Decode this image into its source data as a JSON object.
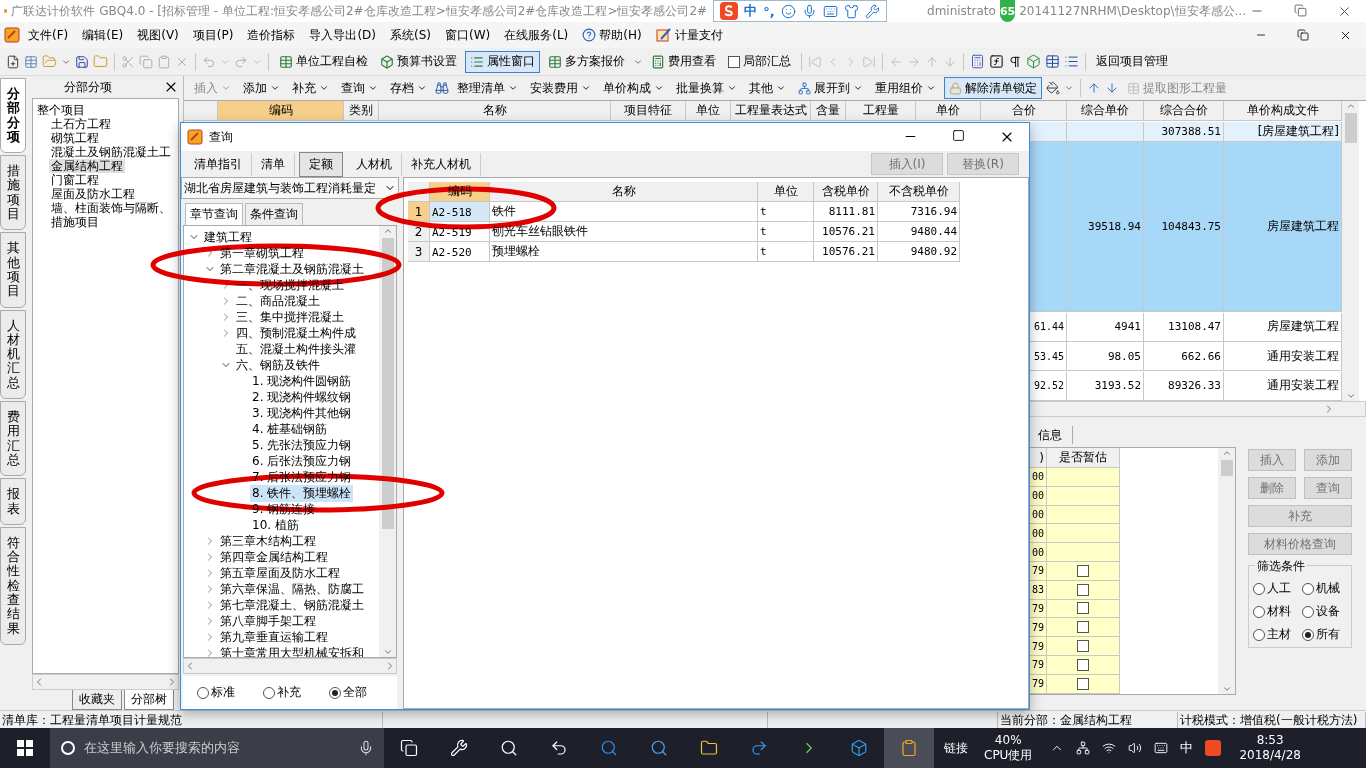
{
  "title_bar": {
    "title": "广联达计价软件 GBQ4.0 - [招标管理 - 单位工程:恒安孝感公司2#仓库改造工程>恒安孝感公司2#仓库改造工程>恒安孝感公司2#",
    "ime_items": [
      "中",
      "°,"
    ],
    "badge": "65",
    "tail_1": "dministrato",
    "tail_2": "20141127NRHM\\Desktop\\恒安孝感公..."
  },
  "menu_bar": {
    "items": [
      "文件(F)",
      "编辑(E)",
      "视图(V)",
      "项目(P)",
      "造价指标",
      "导入导出(D)",
      "系统(S)",
      "窗口(W)",
      "在线服务(L)",
      "帮助(H)",
      "计量支付"
    ]
  },
  "toolbar": {
    "buttons": [
      {
        "label": "单位工程自检",
        "pressed": false
      },
      {
        "label": "预算书设置",
        "pressed": false
      },
      {
        "label": "属性窗口",
        "pressed": true
      },
      {
        "label": "多方案报价",
        "pressed": false
      },
      {
        "label": "费用查看",
        "pressed": false
      }
    ],
    "checkbox": {
      "label": "局部汇总",
      "checked": false
    },
    "return_button": "返回项目管理"
  },
  "side_tabs": [
    {
      "label": "分部分项",
      "selected": true
    },
    {
      "label": "措施项目",
      "selected": false
    },
    {
      "label": "其他项目",
      "selected": false
    },
    {
      "label": "人材机汇总",
      "selected": false
    },
    {
      "label": "费用汇总",
      "selected": false
    },
    {
      "label": "报表",
      "selected": false
    },
    {
      "label": "符合性检查结果",
      "selected": false
    }
  ],
  "left_panel": {
    "title": "分部分项",
    "tree": {
      "label": "整个项目",
      "selected": false,
      "children": [
        {
          "label": "土石方工程",
          "selected": false
        },
        {
          "label": "砌筑工程",
          "selected": false
        },
        {
          "label": "混凝土及钢筋混凝土工",
          "selected": false
        },
        {
          "label": "金属结构工程",
          "selected": true
        },
        {
          "label": "门窗工程",
          "selected": false
        },
        {
          "label": "屋面及防水工程",
          "selected": false
        },
        {
          "label": "墙、柱面装饰与隔断、",
          "selected": false
        },
        {
          "label": "措施项目",
          "selected": false
        }
      ]
    },
    "bottom_tabs": [
      {
        "label": "收藏夹",
        "selected": false
      },
      {
        "label": "分部树",
        "selected": true
      }
    ]
  },
  "edit_toolbar": {
    "items": [
      {
        "label": "插入",
        "dropdown": true,
        "disabled": true,
        "pressed": false
      },
      {
        "label": "添加",
        "dropdown": true,
        "disabled": false,
        "pressed": false
      },
      {
        "label": "补充",
        "dropdown": true,
        "disabled": false,
        "pressed": false
      },
      {
        "label": "查询",
        "dropdown": true,
        "disabled": false,
        "pressed": false
      },
      {
        "label": "存档",
        "dropdown": true,
        "disabled": false,
        "pressed": false
      },
      {
        "label": "整理清单",
        "dropdown": true,
        "disabled": false,
        "pressed": false
      },
      {
        "label": "安装费用",
        "dropdown": true,
        "disabled": false,
        "pressed": false
      },
      {
        "label": "单价构成",
        "dropdown": true,
        "disabled": false,
        "pressed": false
      },
      {
        "label": "批量换算",
        "dropdown": true,
        "disabled": false,
        "pressed": false
      },
      {
        "label": "其他",
        "dropdown": true,
        "disabled": false,
        "pressed": false
      },
      {
        "label": "展开到",
        "dropdown": true,
        "disabled": false,
        "pressed": false
      },
      {
        "label": "重用组价",
        "dropdown": true,
        "disabled": false,
        "pressed": false
      },
      {
        "label": "解除清单锁定",
        "dropdown": false,
        "disabled": false,
        "pressed": true
      },
      {
        "label": "提取图形工程量",
        "dropdown": false,
        "disabled": true,
        "pressed": false
      }
    ]
  },
  "main_table": {
    "columns": [
      {
        "label": "编码",
        "selected": true
      },
      {
        "label": "类别",
        "selected": false
      },
      {
        "label": "名称",
        "selected": false
      },
      {
        "label": "项目特征",
        "selected": false
      },
      {
        "label": "单位",
        "selected": false
      },
      {
        "label": "工程量表达式",
        "selected": false
      },
      {
        "label": "含量",
        "selected": false
      },
      {
        "label": "工程量",
        "selected": false
      },
      {
        "label": "单价",
        "selected": false
      },
      {
        "label": "合价",
        "selected": false
      },
      {
        "label": "综合单价",
        "selected": false
      },
      {
        "label": "综合合价",
        "selected": false
      },
      {
        "label": "单价构成文件",
        "selected": false
      }
    ],
    "rows": [
      {
        "kind": "section",
        "selected": false,
        "total": "",
        "unit_price": "",
        "total_price": "307388.51",
        "template": "[房屋建筑工程]"
      },
      {
        "kind": "item",
        "selected": true,
        "total": "",
        "unit_price": "39518.94",
        "total_price": "104843.75",
        "template": "房屋建筑工程"
      },
      {
        "kind": "item",
        "selected": false,
        "total": "61.44",
        "unit_price": "4941",
        "total_price": "13108.47",
        "template": "房屋建筑工程"
      },
      {
        "kind": "item",
        "selected": false,
        "total": "53.45",
        "unit_price": "98.05",
        "total_price": "662.66",
        "template": "通用安装工程"
      },
      {
        "kind": "item",
        "selected": false,
        "total": "92.52",
        "unit_price": "3193.52",
        "total_price": "89326.33",
        "template": "通用安装工程"
      }
    ]
  },
  "lower_panel": {
    "tab": "信息",
    "columns": [
      ")",
      "是否暂估"
    ],
    "rows": [
      {
        "value": "00",
        "kind": "plain"
      },
      {
        "value": "00",
        "kind": "plain"
      },
      {
        "value": "00",
        "kind": "plain"
      },
      {
        "value": "00",
        "kind": "plain"
      },
      {
        "value": "00",
        "kind": "plain"
      },
      {
        "value": "79",
        "kind": "check",
        "checked": false
      },
      {
        "value": "83",
        "kind": "check",
        "checked": false
      },
      {
        "value": "79",
        "kind": "check",
        "checked": false
      },
      {
        "value": "79",
        "kind": "check",
        "checked": false
      },
      {
        "value": "79",
        "kind": "check",
        "checked": false
      },
      {
        "value": "79",
        "kind": "check",
        "checked": false
      },
      {
        "value": "79",
        "kind": "check",
        "checked": false
      }
    ],
    "buttons": [
      {
        "label": "插入",
        "disabled": true,
        "wide": false
      },
      {
        "label": "添加",
        "disabled": true,
        "wide": false
      },
      {
        "label": "删除",
        "disabled": true,
        "wide": false
      },
      {
        "label": "查询",
        "disabled": true,
        "wide": false
      },
      {
        "label": "补充",
        "disabled": true,
        "wide": true
      },
      {
        "label": "材料价格查询",
        "disabled": true,
        "wide": true
      }
    ],
    "filter": {
      "title": "筛选条件",
      "options": [
        {
          "label": "人工",
          "selected": false
        },
        {
          "label": "机械",
          "selected": false
        },
        {
          "label": "材料",
          "selected": false
        },
        {
          "label": "设备",
          "selected": false
        },
        {
          "label": "主材",
          "selected": false
        },
        {
          "label": "所有",
          "selected": true
        }
      ]
    }
  },
  "dialog": {
    "title": "查询",
    "tabs": [
      {
        "label": "清单指引",
        "selected": false
      },
      {
        "label": "清单",
        "selected": false
      },
      {
        "label": "定额",
        "selected": true
      },
      {
        "label": "人材机",
        "selected": false
      },
      {
        "label": "补充人材机",
        "selected": false
      }
    ],
    "actions": [
      {
        "label": "插入(I)",
        "disabled": true
      },
      {
        "label": "替换(R)",
        "disabled": true
      }
    ],
    "library": "湖北省房屋建筑与装饰工程消耗量定",
    "search_tabs": [
      {
        "label": "章节查询",
        "selected": true
      },
      {
        "label": "条件查询",
        "selected": false
      }
    ],
    "tree": [
      {
        "label": "建筑工程",
        "expanded": true,
        "selected": false,
        "children": [
          {
            "label": "第一章砌筑工程",
            "expanded": false,
            "selected": false
          },
          {
            "label": "第二章混凝土及钢筋混凝土",
            "expanded": true,
            "selected": false,
            "children": [
              {
                "label": "一、现场搅拌混凝土",
                "expanded": false,
                "selected": false
              },
              {
                "label": "二、商品混凝土",
                "expanded": false,
                "selected": false
              },
              {
                "label": "三、集中搅拌混凝土",
                "expanded": false,
                "selected": false
              },
              {
                "label": "四、预制混凝土构件成",
                "expanded": false,
                "selected": false
              },
              {
                "label": "五、混凝土构件接头灌",
                "selected": false
              },
              {
                "label": "六、钢筋及铁件",
                "expanded": true,
                "selected": false,
                "children": [
                  {
                    "label": "1. 现浇构件圆钢筋",
                    "selected": false
                  },
                  {
                    "label": "2. 现浇构件螺纹钢",
                    "selected": false
                  },
                  {
                    "label": "3. 现浇构件其他钢",
                    "selected": false
                  },
                  {
                    "label": "4. 桩基础钢筋",
                    "selected": false
                  },
                  {
                    "label": "5. 先张法预应力钢",
                    "selected": false
                  },
                  {
                    "label": "6. 后张法预应力钢",
                    "selected": false
                  },
                  {
                    "label": "7. 后张法预应力钢",
                    "selected": false
                  },
                  {
                    "label": "8. 铁件、预埋螺栓",
                    "selected": true
                  },
                  {
                    "label": "9. 钢筋连接",
                    "selected": false
                  },
                  {
                    "label": "10. 植筋",
                    "selected": false
                  }
                ]
              }
            ]
          },
          {
            "label": "第三章木结构工程",
            "expanded": false,
            "selected": false
          },
          {
            "label": "第四章金属结构工程",
            "expanded": false,
            "selected": false
          },
          {
            "label": "第五章屋面及防水工程",
            "expanded": false,
            "selected": false
          },
          {
            "label": "第六章保温、隔热、防腐工",
            "expanded": false,
            "selected": false
          },
          {
            "label": "第七章混凝土、钢筋混凝土",
            "expanded": false,
            "selected": false
          },
          {
            "label": "第八章脚手架工程",
            "expanded": false,
            "selected": false
          },
          {
            "label": "第九章垂直运输工程",
            "expanded": false,
            "selected": false
          },
          {
            "label": "第十章常用大型机械安拆和",
            "expanded": false,
            "selected": false
          }
        ]
      }
    ],
    "filters": [
      {
        "label": "标准",
        "selected": false
      },
      {
        "label": "补充",
        "selected": false
      },
      {
        "label": "全部",
        "selected": true
      }
    ],
    "table": {
      "columns": [
        {
          "label": "编码",
          "selected": true
        },
        {
          "label": "名称",
          "selected": false
        },
        {
          "label": "单位",
          "selected": false
        },
        {
          "label": "含税单价",
          "selected": false
        },
        {
          "label": "不含税单价",
          "selected": false
        }
      ],
      "rows": [
        {
          "index": "1",
          "code": "A2-518",
          "name": "铁件",
          "unit": "t",
          "price_tax": "8111.81",
          "price_net": "7316.94",
          "selected": true
        },
        {
          "index": "2",
          "code": "A2-519",
          "name": "刨光车丝钻眼铁件",
          "unit": "t",
          "price_tax": "10576.21",
          "price_net": "9480.44",
          "selected": false
        },
        {
          "index": "3",
          "code": "A2-520",
          "name": "预埋螺栓",
          "unit": "t",
          "price_tax": "10576.21",
          "price_net": "9480.92",
          "selected": false
        }
      ]
    }
  },
  "status_bar": {
    "items": [
      "清单库：工程量清单项目计量规范",
      "当前分部：金属结构工程",
      "计税模式：增值税(一般计税方法)"
    ]
  },
  "taskbar": {
    "search_placeholder": "在这里输入你要搜索的内容",
    "link_label": "链接",
    "cpu_value": "40%",
    "cpu_label": "CPU使用",
    "ime": "中",
    "time": "8:53",
    "date": "2018/4/28"
  }
}
